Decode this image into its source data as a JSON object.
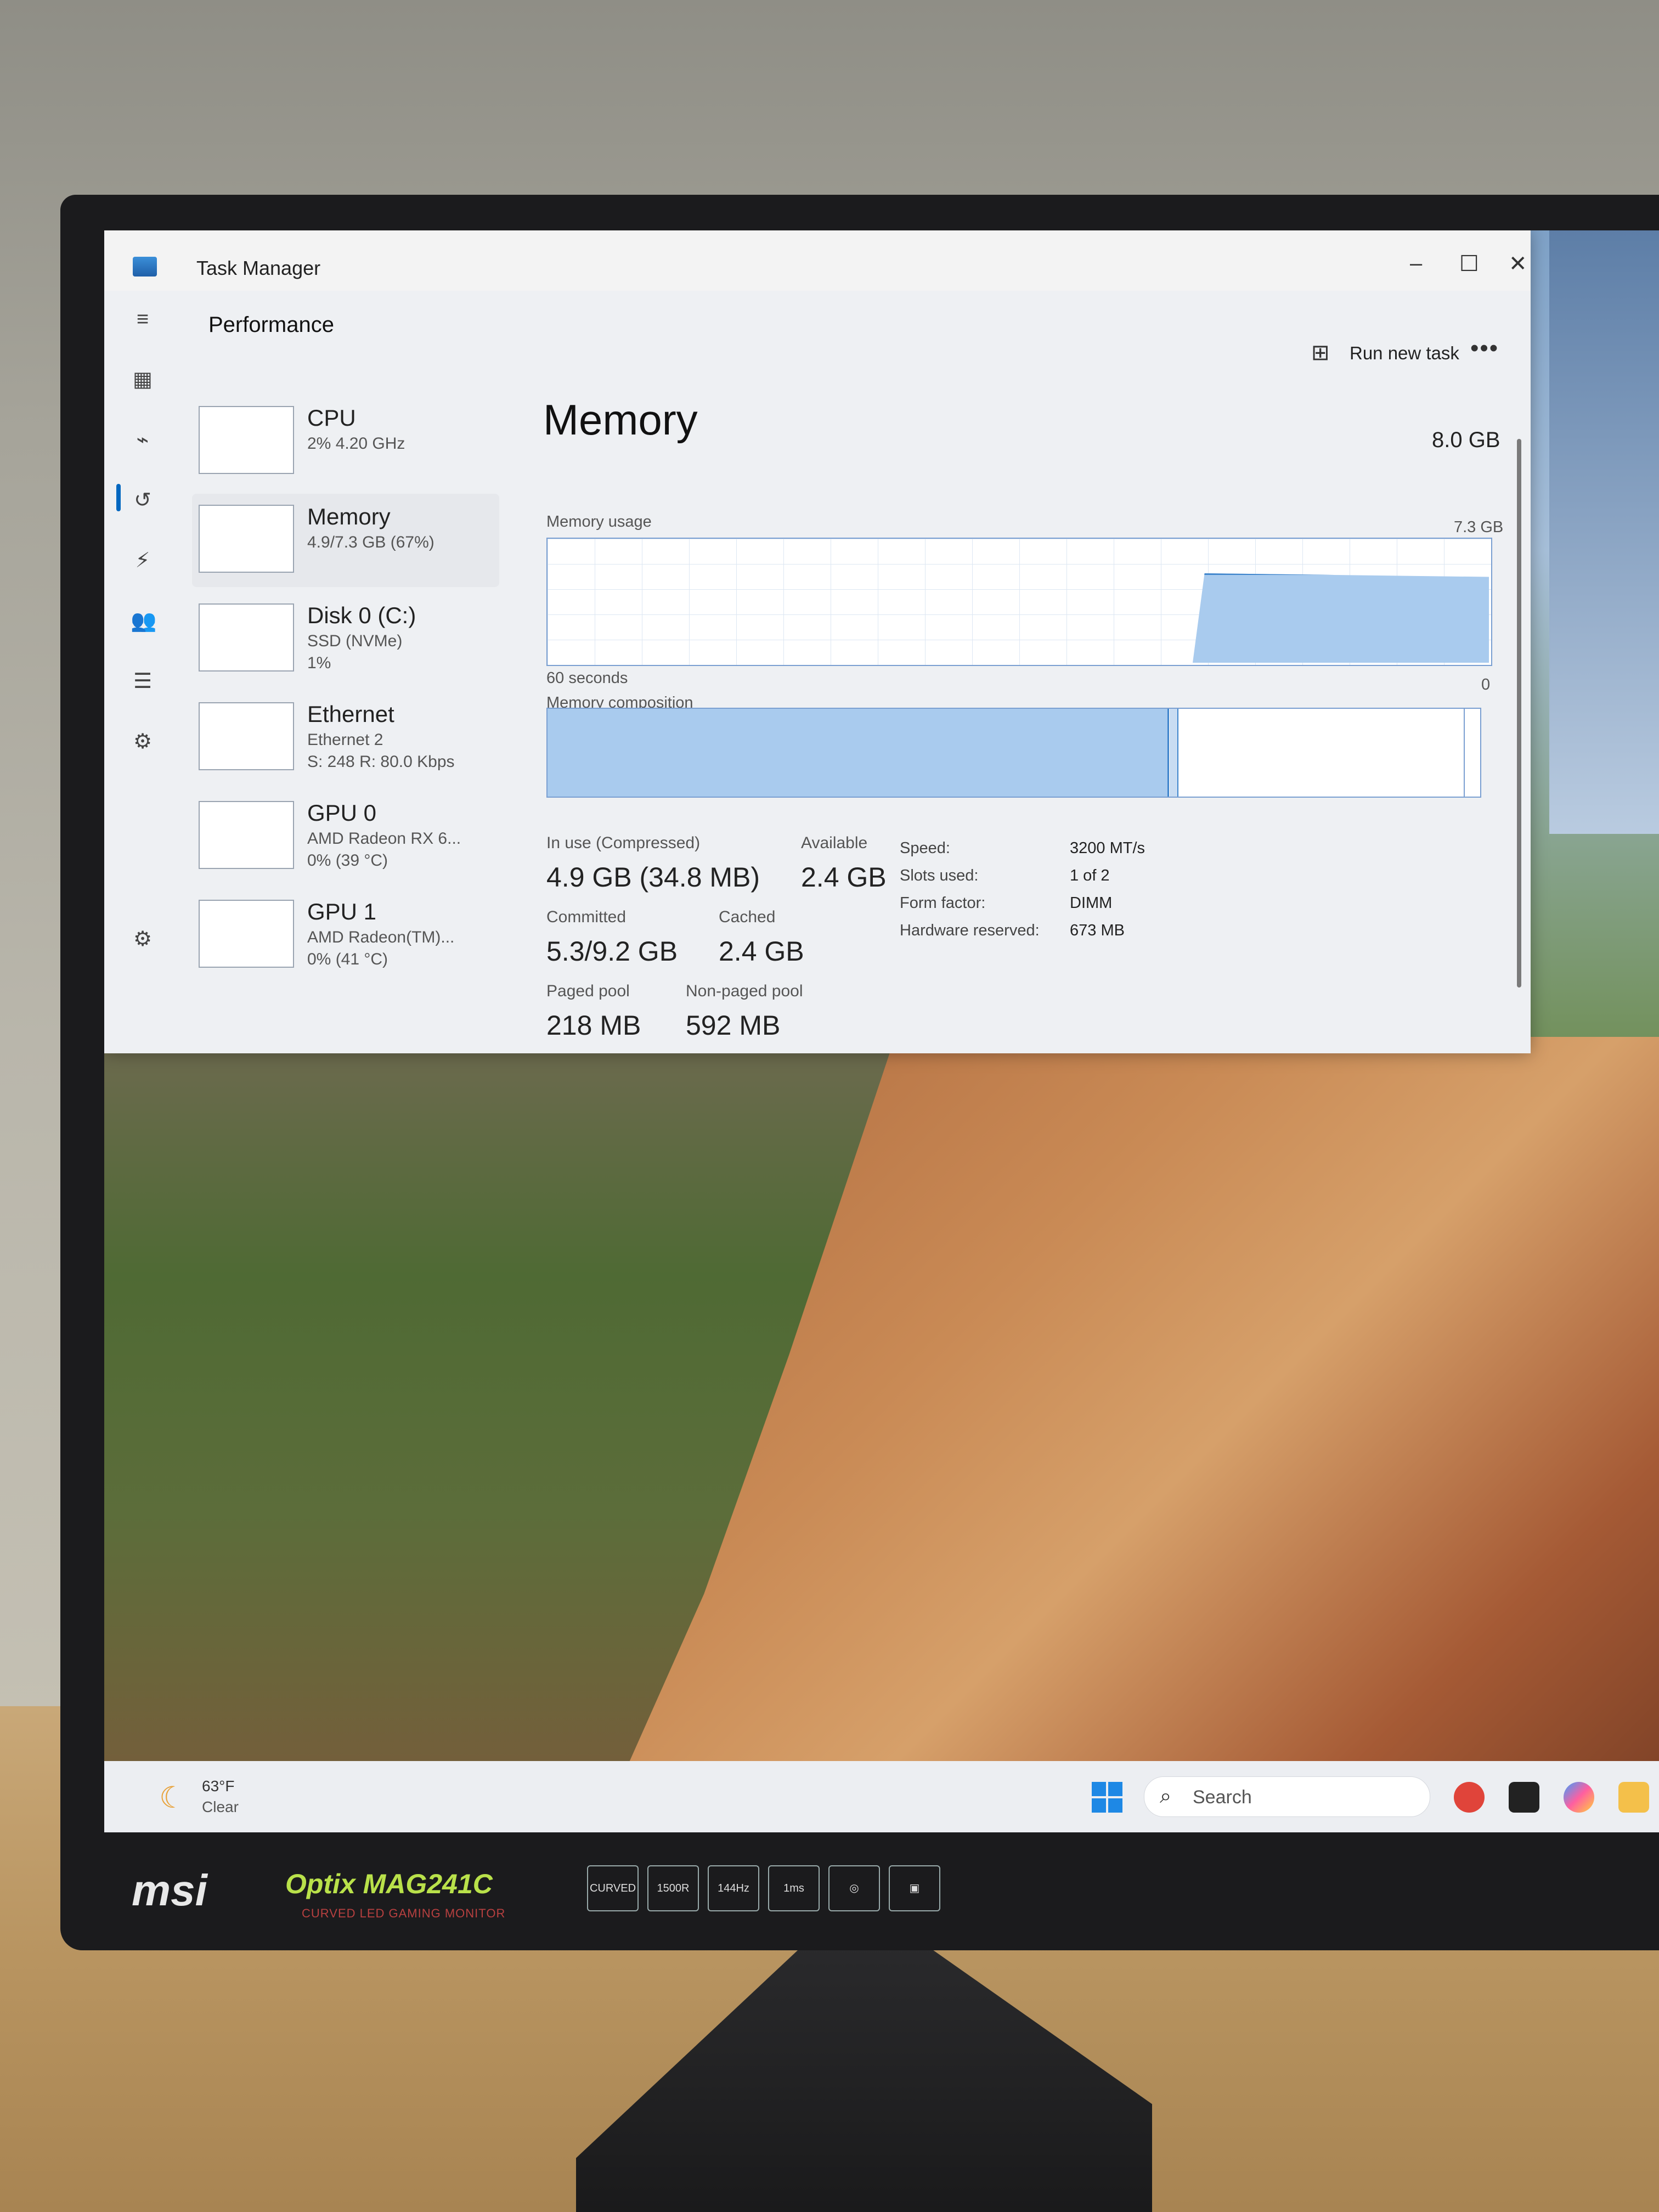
{
  "window": {
    "title": "Task Manager",
    "minimize": "–",
    "maximize": "☐",
    "close": "✕",
    "section": "Performance",
    "run_new_task": "Run new task",
    "more": "•••"
  },
  "sidebar": {
    "items": [
      {
        "name": "CPU",
        "sub1": "2% 4.20 GHz",
        "sub2": "",
        "sub3": ""
      },
      {
        "name": "Memory",
        "sub1": "4.9/7.3 GB (67%)",
        "sub2": "",
        "sub3": ""
      },
      {
        "name": "Disk 0 (C:)",
        "sub1": "SSD (NVMe)",
        "sub2": "1%",
        "sub3": ""
      },
      {
        "name": "Ethernet",
        "sub1": "Ethernet 2",
        "sub2": "S: 248 R: 80.0 Kbps",
        "sub3": ""
      },
      {
        "name": "GPU 0",
        "sub1": "AMD Radeon RX 6...",
        "sub2": "0% (39 °C)",
        "sub3": ""
      },
      {
        "name": "GPU 1",
        "sub1": "AMD Radeon(TM)...",
        "sub2": "0% (41 °C)",
        "sub3": ""
      }
    ]
  },
  "memory": {
    "title": "Memory",
    "total": "8.0 GB",
    "usage_label": "Memory usage",
    "usage_max": "7.3 GB",
    "time_label": "60 seconds",
    "zero": "0",
    "composition_label": "Memory composition",
    "in_use_label": "In use (Compressed)",
    "in_use_value": "4.9 GB (34.8 MB)",
    "available_label": "Available",
    "available_value": "2.4 GB",
    "committed_label": "Committed",
    "committed_value": "5.3/9.2 GB",
    "cached_label": "Cached",
    "cached_value": "2.4 GB",
    "paged_label": "Paged pool",
    "paged_value": "218 MB",
    "nonpaged_label": "Non-paged pool",
    "nonpaged_value": "592 MB",
    "speed_label": "Speed:",
    "speed_value": "3200 MT/s",
    "slots_label": "Slots used:",
    "slots_value": "1 of 2",
    "form_label": "Form factor:",
    "form_value": "DIMM",
    "hw_label": "Hardware reserved:",
    "hw_value": "673 MB"
  },
  "taskbar": {
    "temp": "63°F",
    "condition": "Clear",
    "search_placeholder": "Search"
  },
  "monitor": {
    "brand": "msi",
    "model": "Optix MAG241C",
    "subtitle": "CURVED LED GAMING MONITOR",
    "badges": [
      "CURVED",
      "1500R",
      "144Hz",
      "1ms",
      "",
      ""
    ]
  },
  "colors": {
    "accent": "#0067c0",
    "graph_fill": "#a9cbee",
    "graph_line": "#3f85cc"
  }
}
